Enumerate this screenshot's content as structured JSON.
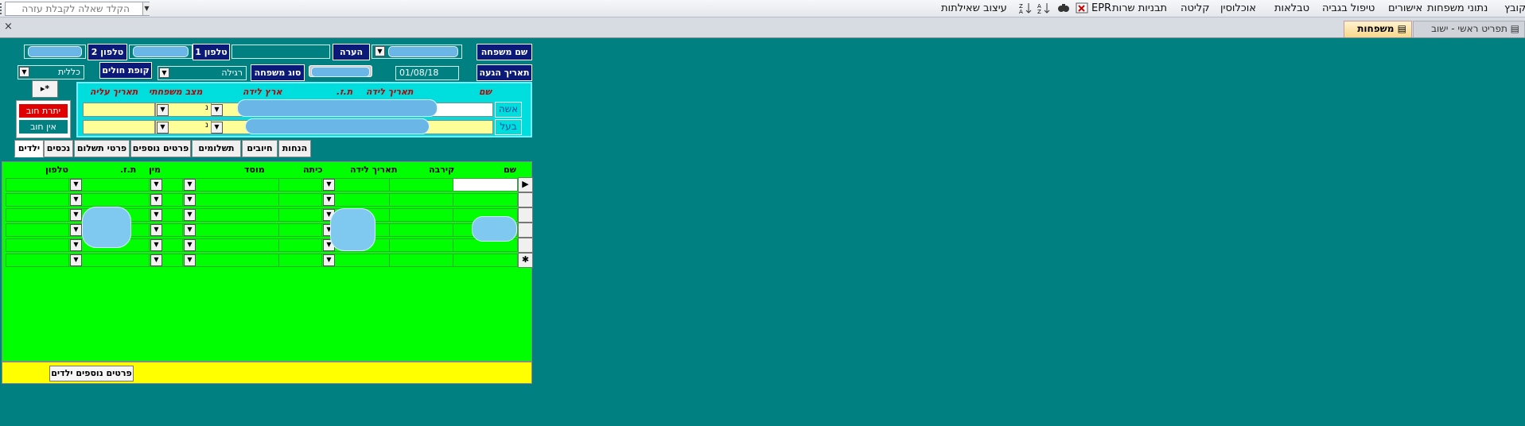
{
  "menu": {
    "items": [
      "קובץ",
      "נתוני משפחות",
      "אישורים",
      "טיפול בגביה",
      "טבלאות",
      "אוכלוסין",
      "קליטה",
      "תבניות שרות",
      "EPR",
      "עיצוב שאילתות"
    ],
    "help_placeholder": "הקלד שאלה לקבלת עזרה"
  },
  "tabs": {
    "main_form": "תפריט ראשי - ישוב",
    "families": "משפחות",
    "close": "×"
  },
  "form": {
    "family_name_label": "שם משפחה",
    "note_label": "הערה",
    "phone1_label": "טלפון 1",
    "phone2_label": "טלפון 2",
    "arrival_date_label": "תאריך הגעה",
    "arrival_date_value": "01/08/18",
    "family_type_label": "סוג משפחה",
    "family_type_value": "רגילה",
    "hmo_label": "קופת חולים",
    "hmo_value": "כללית",
    "new_record_icon": "▸*"
  },
  "persons": {
    "headers": [
      "שם",
      "תאריך לידה",
      "ת.ז.",
      "ארץ לידה",
      "מצב משפחתי",
      "תאריך עליה"
    ],
    "rows": [
      {
        "role": "אשה",
        "status_value": "נ"
      },
      {
        "role": "בעל",
        "status_value": "נ"
      }
    ]
  },
  "debt": {
    "has_debt": "יתרת חוב",
    "no_debt": "אין חוב"
  },
  "subtabs": [
    "ילדים",
    "נכסים",
    "פרטי תשלום",
    "פרטים נוספים",
    "תשלומים",
    "חיובים",
    "הנחות"
  ],
  "children": {
    "headers": [
      "שם",
      "קירבה",
      "תאריך לידה",
      "כיתה",
      "מוסד",
      "מין",
      "ת.ז.",
      "טלפון"
    ],
    "row_count": 6,
    "current_marker": "▶",
    "new_marker": "✱"
  },
  "footer": {
    "more_children_button": "פרטים נוספים ילדים"
  },
  "colors": {
    "background": "#008080",
    "label_bg": "#0b1a78",
    "grid_bg": "#00ff00",
    "persons_bg": "#00dddd",
    "debt_bg": "#e00000"
  }
}
